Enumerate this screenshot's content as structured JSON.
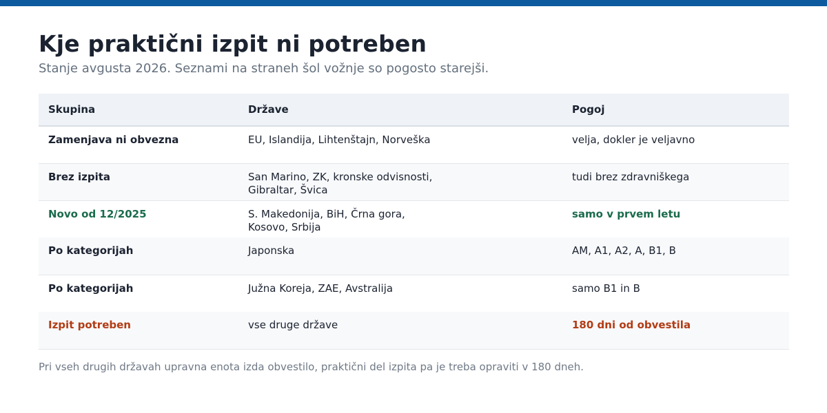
{
  "header": {
    "title": "Kje praktični izpit ni potreben",
    "subtitle": "Stanje avgusta 2026. Seznami na straneh šol vožnje so pogosto starejši."
  },
  "table": {
    "columns": [
      "Skupina",
      "Države",
      "Pogoj"
    ],
    "rows": [
      {
        "group": "Zamenjava ni obvezna",
        "countries": "EU, Islandija, Lihtenštajn, Norveška",
        "condition": "velja, dokler je veljavno",
        "accent": "none"
      },
      {
        "group": "Brez izpita",
        "countries": "San Marino, ZK, kronske odvisnosti,\nGibraltar, Švica",
        "condition": "tudi brez zdravniškega",
        "accent": "none"
      },
      {
        "group": "Novo od 12/2025",
        "countries": "S. Makedonija, BiH, Črna gora,\nKosovo, Srbija",
        "condition": "samo v prvem letu",
        "accent": "green"
      },
      {
        "group": "Po kategorijah",
        "countries": "Japonska",
        "condition": "AM, A1, A2, A, B1, B",
        "accent": "none"
      },
      {
        "group": "Po kategorijah",
        "countries": "Južna Koreja, ZAE, Avstralija",
        "condition": "samo B1 in B",
        "accent": "none"
      },
      {
        "group": "Izpit potreben",
        "countries": "vse druge države",
        "condition": "180 dni od obvestila",
        "accent": "orange"
      }
    ]
  },
  "footer": {
    "note": "Pri vseh drugih državah upravna enota izda obvestilo, praktični del izpita pa je treba opraviti v 180 dneh."
  },
  "colors": {
    "top_bar": "#0d5a9e",
    "accent_green": "#1a6b4c",
    "accent_orange": "#b23c14"
  }
}
